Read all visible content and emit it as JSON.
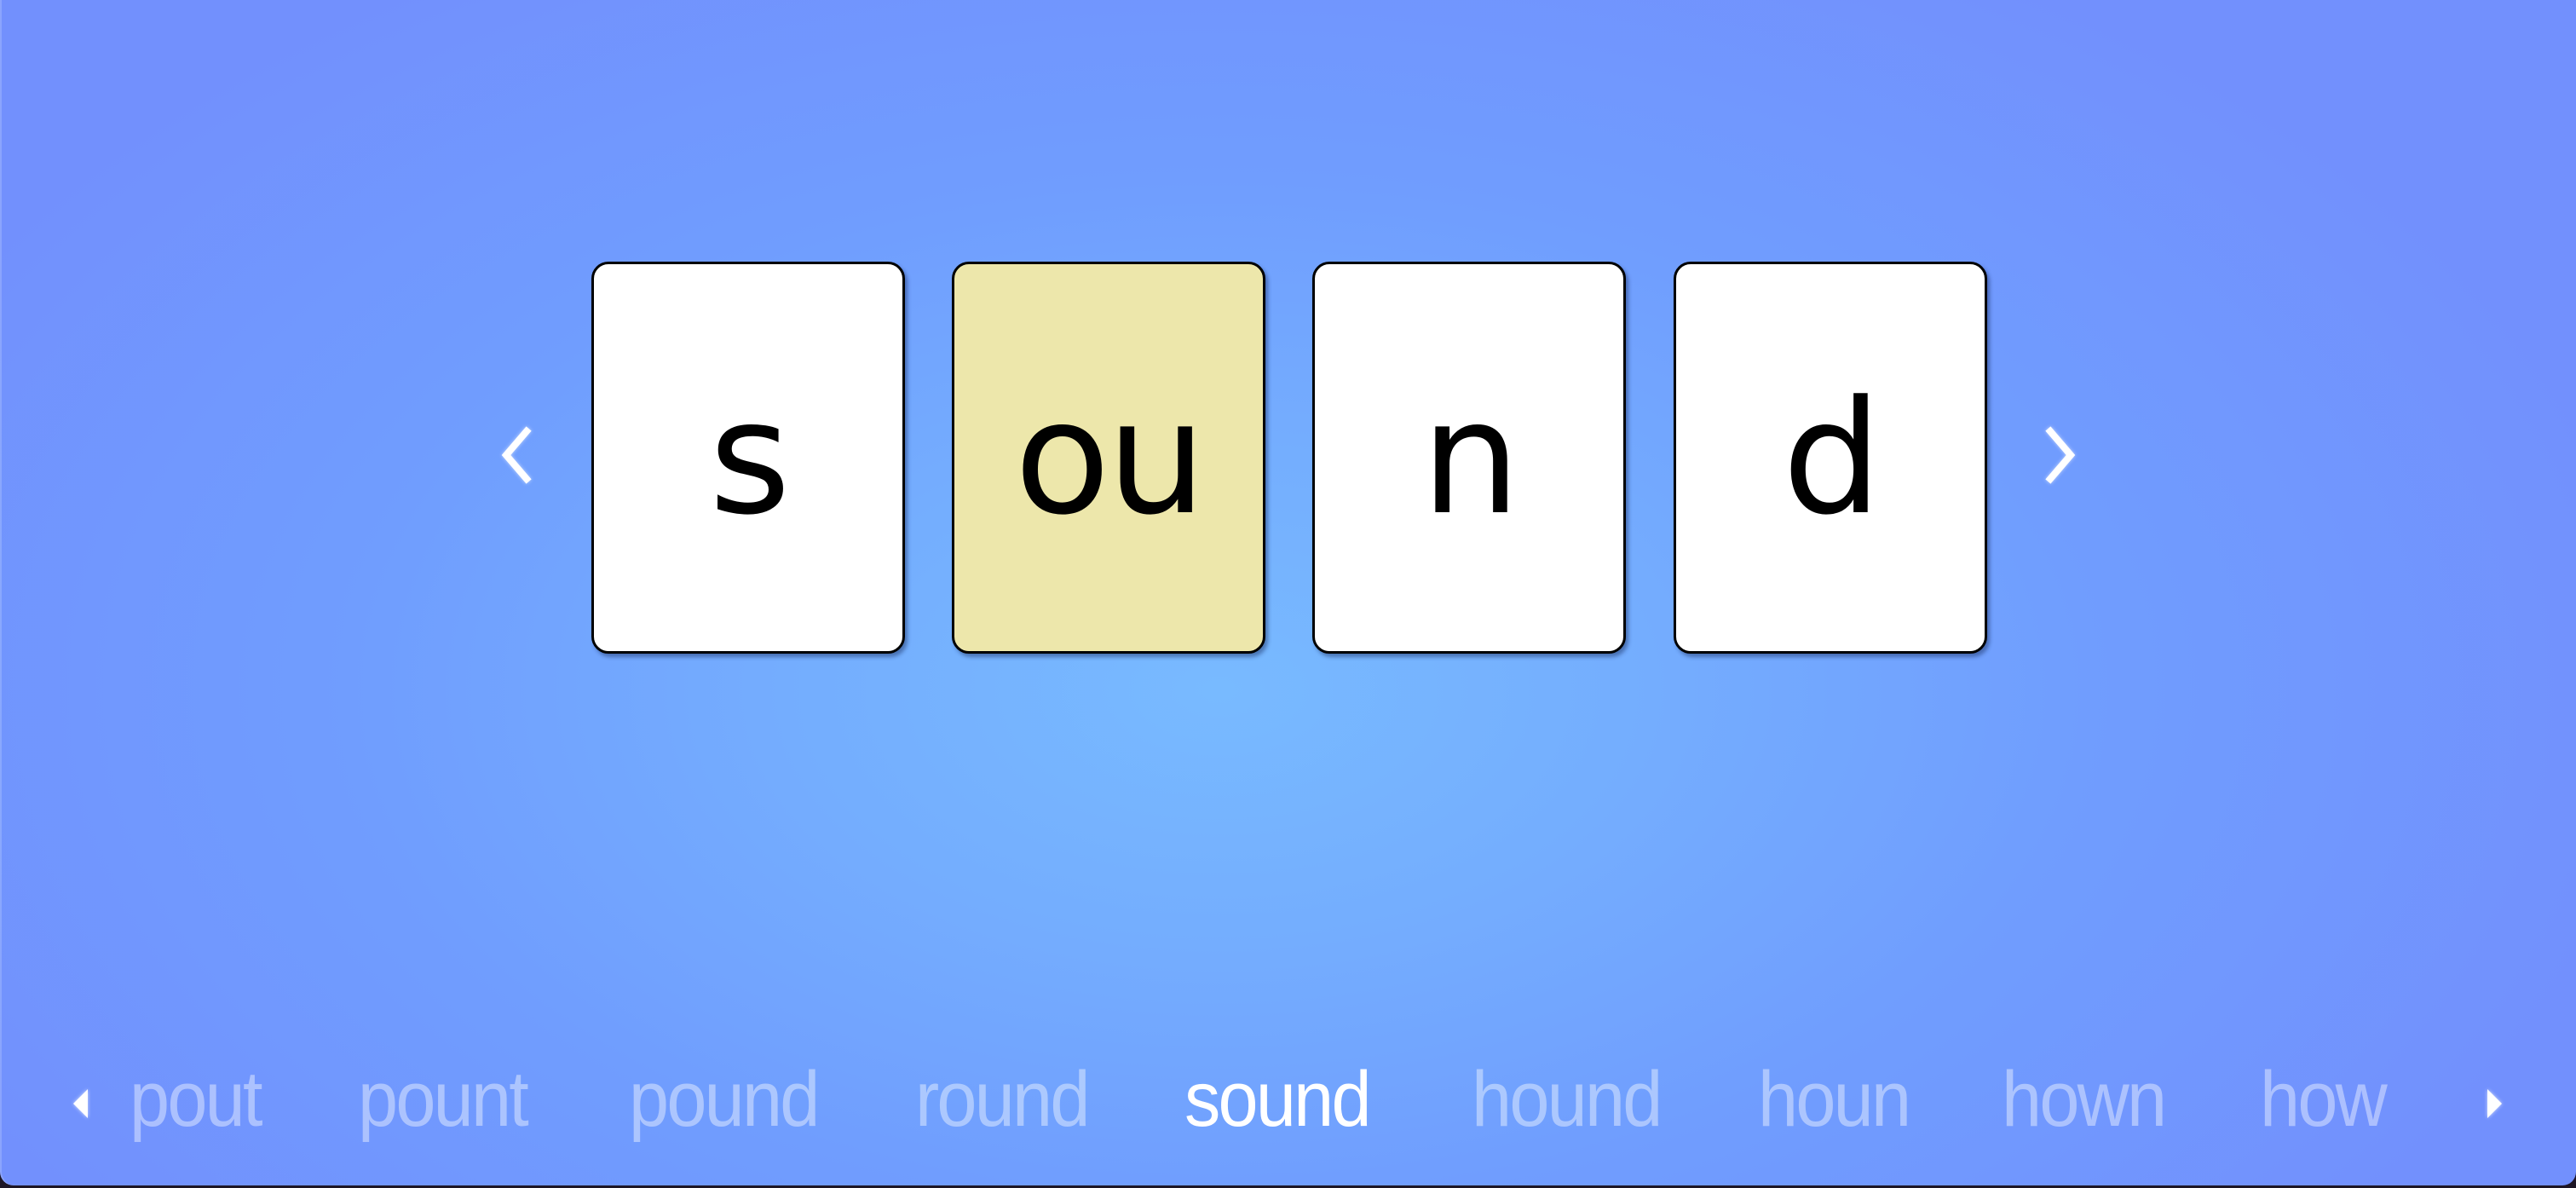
{
  "word_builder": {
    "current_word": "sound",
    "tiles": [
      {
        "text": "s",
        "highlighted": false
      },
      {
        "text": "ou",
        "highlighted": true
      },
      {
        "text": "n",
        "highlighted": false
      },
      {
        "text": "d",
        "highlighted": false
      }
    ],
    "prev_icon": "chevron-left-icon",
    "next_icon": "chevron-right-icon"
  },
  "word_list": {
    "words": [
      "pout",
      "pount",
      "pound",
      "round",
      "sound",
      "hound",
      "houn",
      "hown",
      "how"
    ],
    "selected_index": 4,
    "prev_icon": "triangle-left-icon",
    "next_icon": "triangle-right-icon"
  },
  "colors": {
    "tile_highlight": "#ede7ab",
    "tile_default": "#ffffff",
    "background_center": "#78baff",
    "background_edge": "#7090fd",
    "word_inactive": "#a8c4fe",
    "word_active": "#ffffff"
  }
}
